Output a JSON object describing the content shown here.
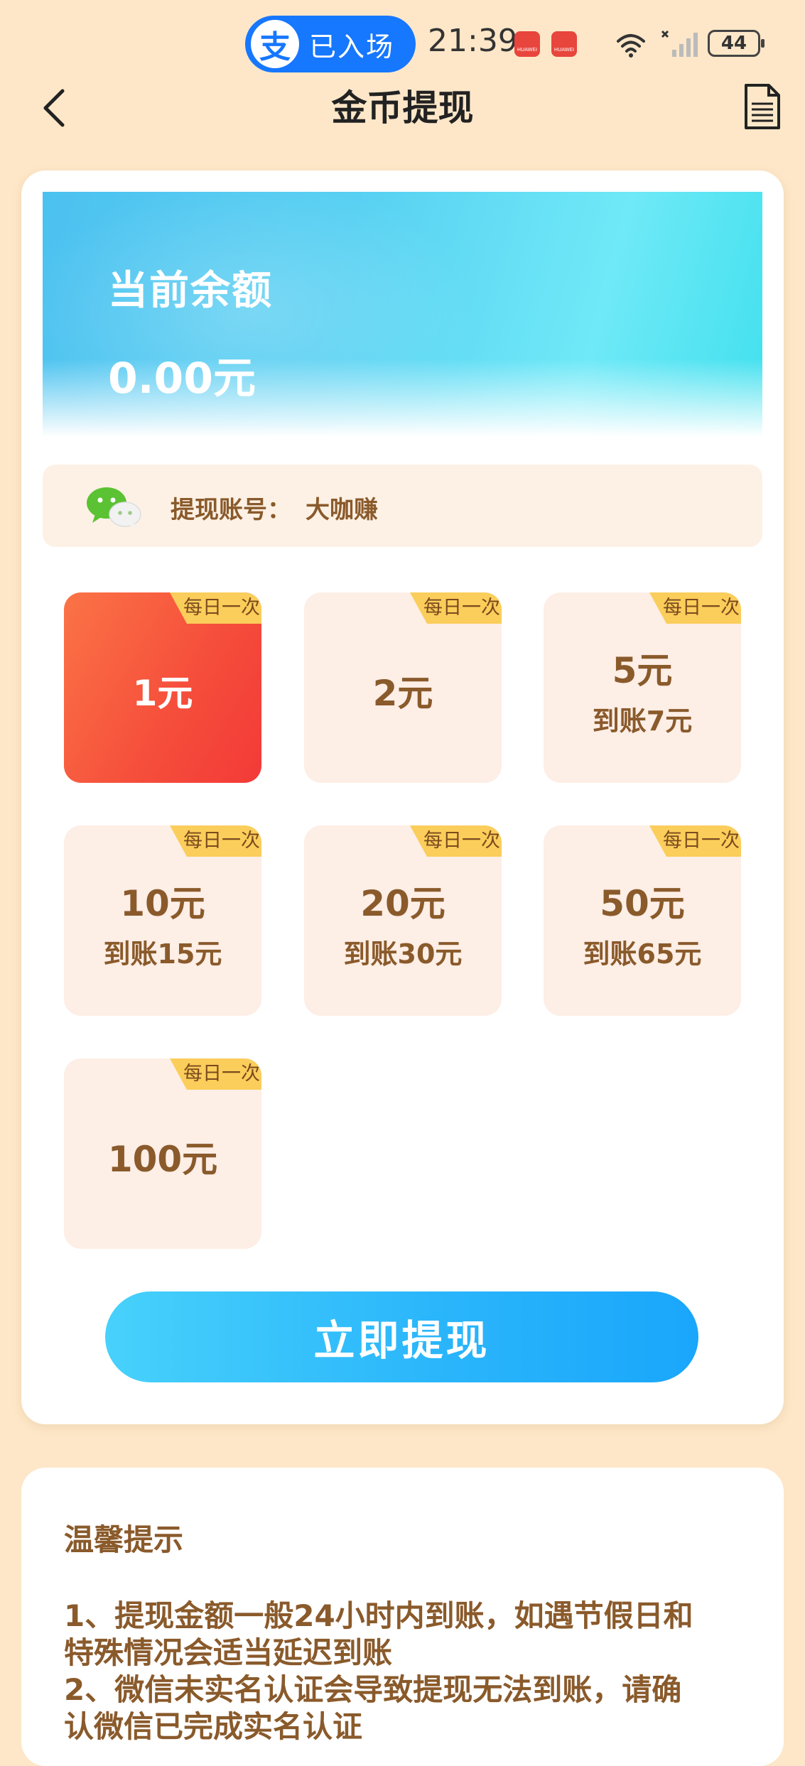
{
  "status_bar": {
    "app_pill_label": "已入场",
    "app_pill_logo": "支",
    "time": "21:39",
    "badge_text": "HUAWEI",
    "battery": "44",
    "network_label": "6"
  },
  "header": {
    "title": "金币提现"
  },
  "balance": {
    "label": "当前余额",
    "value": "0.00元"
  },
  "account": {
    "label": "提现账号：",
    "name": "大咖赚"
  },
  "options": [
    {
      "tag": "每日一次",
      "amount": "1元",
      "arrival": "",
      "selected": true
    },
    {
      "tag": "每日一次",
      "amount": "2元",
      "arrival": "",
      "selected": false
    },
    {
      "tag": "每日一次",
      "amount": "5元",
      "arrival": "到账7元",
      "selected": false
    },
    {
      "tag": "每日一次",
      "amount": "10元",
      "arrival": "到账15元",
      "selected": false
    },
    {
      "tag": "每日一次",
      "amount": "20元",
      "arrival": "到账30元",
      "selected": false
    },
    {
      "tag": "每日一次",
      "amount": "50元",
      "arrival": "到账65元",
      "selected": false
    },
    {
      "tag": "每日一次",
      "amount": "100元",
      "arrival": "",
      "selected": false
    }
  ],
  "submit_label": "立即提现",
  "tips": {
    "title": "温馨提示",
    "lines": [
      "1、提现金额一般24小时内到账，如遇节假日和",
      "特殊情况会适当延迟到账",
      "2、微信未实名认证会导致提现无法到账，请确",
      "认微信已完成实名认证"
    ]
  },
  "colors": {
    "background": "#fde7c8",
    "accent_text": "#8a5a2b",
    "selected_start": "#fb7346",
    "selected_end": "#f33a38",
    "button_start": "#47d1fb",
    "button_end": "#1aa6fb",
    "tag": "#fbcd5a"
  },
  "icons": {
    "back": "chevron-left-icon",
    "document": "document-icon",
    "wechat": "wechat-icon",
    "wifi": "wifi-icon",
    "cellular": "cellular-signal-icon",
    "battery": "battery-icon"
  }
}
